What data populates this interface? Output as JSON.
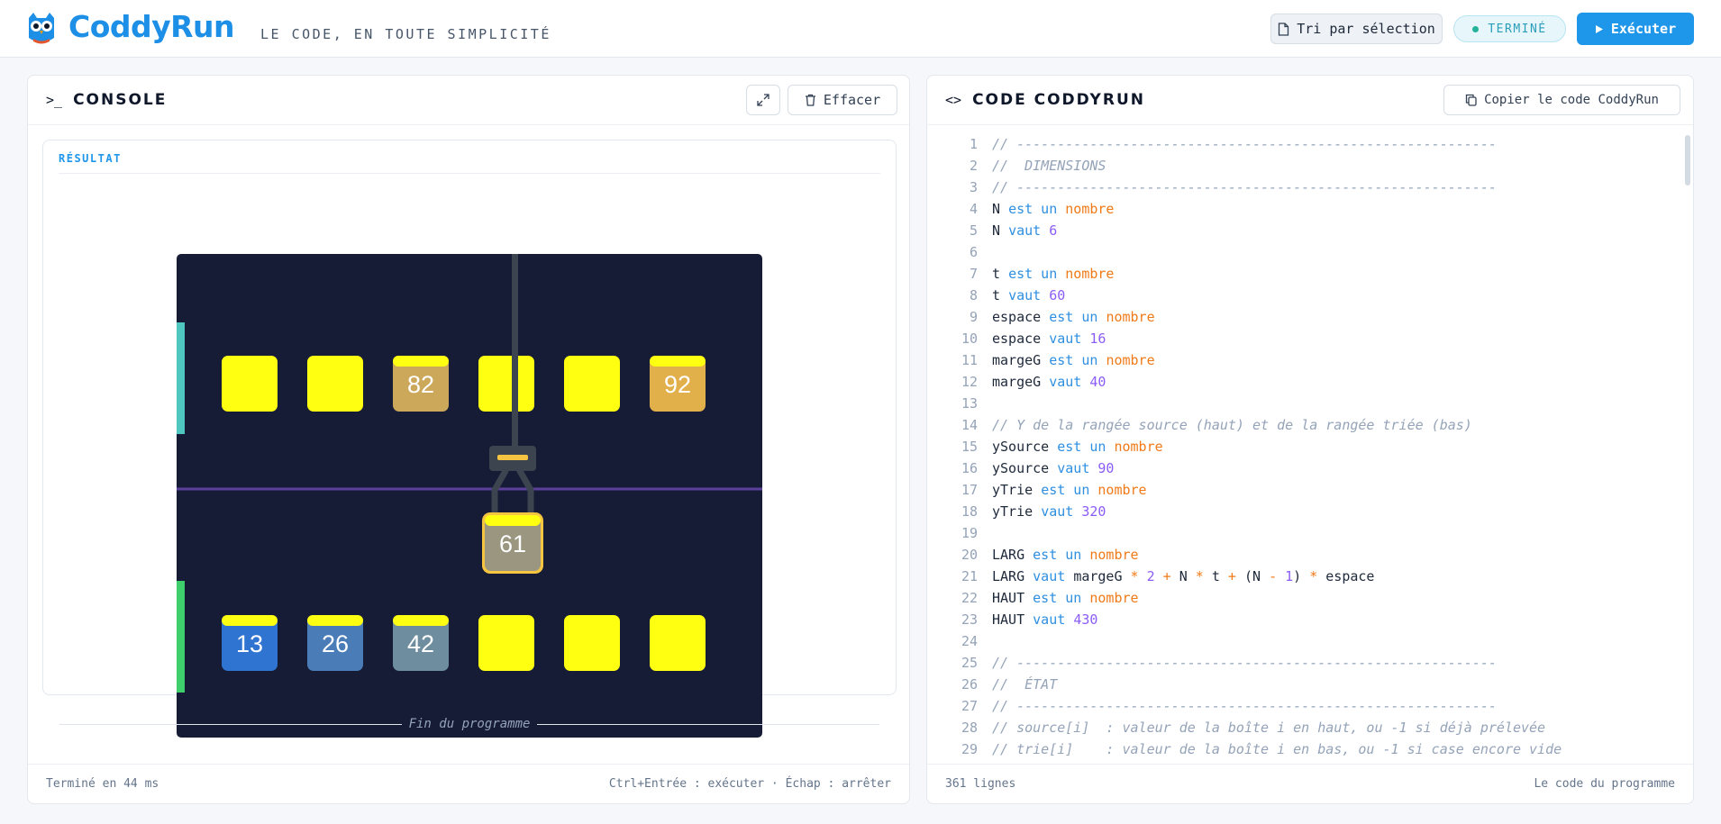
{
  "header": {
    "brand": "CoddyRun",
    "tagline": "LE CODE, EN TOUTE SIMPLICITÉ",
    "algo_label": "Tri par sélection",
    "status": "TERMINÉ",
    "run_label": "Exécuter",
    "accent": "#1e96ea"
  },
  "console": {
    "title": "CONSOLE",
    "clear_label": "Effacer",
    "result_label": "RÉSULTAT",
    "end_text": "Fin du programme",
    "footer_left": "Terminé en 44 ms",
    "footer_right": "Ctrl+Entrée : exécuter · Échap : arrêter"
  },
  "simulation": {
    "background": "#161c36",
    "source_row": [
      {
        "label": "",
        "color": "#ffff12"
      },
      {
        "label": "",
        "color": "#ffff12"
      },
      {
        "label": "82",
        "color": "#cca85a"
      },
      {
        "label": "",
        "color": "#ffff12"
      },
      {
        "label": "",
        "color": "#ffff12"
      },
      {
        "label": "92",
        "color": "#e2b04a"
      }
    ],
    "sorted_row": [
      {
        "label": "13",
        "color": "#2f74d0"
      },
      {
        "label": "26",
        "color": "#4a7db8"
      },
      {
        "label": "42",
        "color": "#6e8ea0"
      },
      {
        "label": "",
        "color": "#ffff12"
      },
      {
        "label": "",
        "color": "#ffff12"
      },
      {
        "label": "",
        "color": "#ffff12"
      }
    ],
    "held_box": {
      "label": "61",
      "color": "#9a9680"
    }
  },
  "code": {
    "title": "CODE CODDYRUN",
    "copy_label": "Copier le code CoddyRun",
    "footer_left": "361 lignes",
    "footer_right": "Le code du programme",
    "lines": [
      [
        [
          "cm",
          "// -----------------------------------------------------------"
        ]
      ],
      [
        [
          "cm",
          "//  DIMENSIONS"
        ]
      ],
      [
        [
          "cm",
          "// -----------------------------------------------------------"
        ]
      ],
      [
        [
          "id",
          "N "
        ],
        [
          "kw",
          "est un "
        ],
        [
          "ty",
          "nombre"
        ]
      ],
      [
        [
          "id",
          "N "
        ],
        [
          "kw",
          "vaut "
        ],
        [
          "nm",
          "6"
        ]
      ],
      [],
      [
        [
          "id",
          "t "
        ],
        [
          "kw",
          "est un "
        ],
        [
          "ty",
          "nombre"
        ]
      ],
      [
        [
          "id",
          "t "
        ],
        [
          "kw",
          "vaut "
        ],
        [
          "nm",
          "60"
        ]
      ],
      [
        [
          "id",
          "espace "
        ],
        [
          "kw",
          "est un "
        ],
        [
          "ty",
          "nombre"
        ]
      ],
      [
        [
          "id",
          "espace "
        ],
        [
          "kw",
          "vaut "
        ],
        [
          "nm",
          "16"
        ]
      ],
      [
        [
          "id",
          "margeG "
        ],
        [
          "kw",
          "est un "
        ],
        [
          "ty",
          "nombre"
        ]
      ],
      [
        [
          "id",
          "margeG "
        ],
        [
          "kw",
          "vaut "
        ],
        [
          "nm",
          "40"
        ]
      ],
      [],
      [
        [
          "cm",
          "// Y de la rangée source (haut) et de la rangée triée (bas)"
        ]
      ],
      [
        [
          "id",
          "ySource "
        ],
        [
          "kw",
          "est un "
        ],
        [
          "ty",
          "nombre"
        ]
      ],
      [
        [
          "id",
          "ySource "
        ],
        [
          "kw",
          "vaut "
        ],
        [
          "nm",
          "90"
        ]
      ],
      [
        [
          "id",
          "yTrie "
        ],
        [
          "kw",
          "est un "
        ],
        [
          "ty",
          "nombre"
        ]
      ],
      [
        [
          "id",
          "yTrie "
        ],
        [
          "kw",
          "vaut "
        ],
        [
          "nm",
          "320"
        ]
      ],
      [],
      [
        [
          "id",
          "LARG "
        ],
        [
          "kw",
          "est un "
        ],
        [
          "ty",
          "nombre"
        ]
      ],
      [
        [
          "id",
          "LARG "
        ],
        [
          "kw",
          "vaut "
        ],
        [
          "id",
          "margeG "
        ],
        [
          "op",
          "* "
        ],
        [
          "nm",
          "2 "
        ],
        [
          "op",
          "+ "
        ],
        [
          "id",
          "N "
        ],
        [
          "op",
          "* "
        ],
        [
          "id",
          "t "
        ],
        [
          "op",
          "+ "
        ],
        [
          "id",
          "(N "
        ],
        [
          "op",
          "- "
        ],
        [
          "nm",
          "1"
        ],
        [
          "id",
          ") "
        ],
        [
          "op",
          "* "
        ],
        [
          "id",
          "espace"
        ]
      ],
      [
        [
          "id",
          "HAUT "
        ],
        [
          "kw",
          "est un "
        ],
        [
          "ty",
          "nombre"
        ]
      ],
      [
        [
          "id",
          "HAUT "
        ],
        [
          "kw",
          "vaut "
        ],
        [
          "nm",
          "430"
        ]
      ],
      [],
      [
        [
          "cm",
          "// -----------------------------------------------------------"
        ]
      ],
      [
        [
          "cm",
          "//  ÉTAT"
        ]
      ],
      [
        [
          "cm",
          "// -----------------------------------------------------------"
        ]
      ],
      [
        [
          "cm",
          "// source[i]  : valeur de la boîte i en haut, ou -1 si déjà prélevée"
        ]
      ],
      [
        [
          "cm",
          "// trie[i]    : valeur de la boîte i en bas, ou -1 si case encore vide"
        ]
      ]
    ]
  }
}
